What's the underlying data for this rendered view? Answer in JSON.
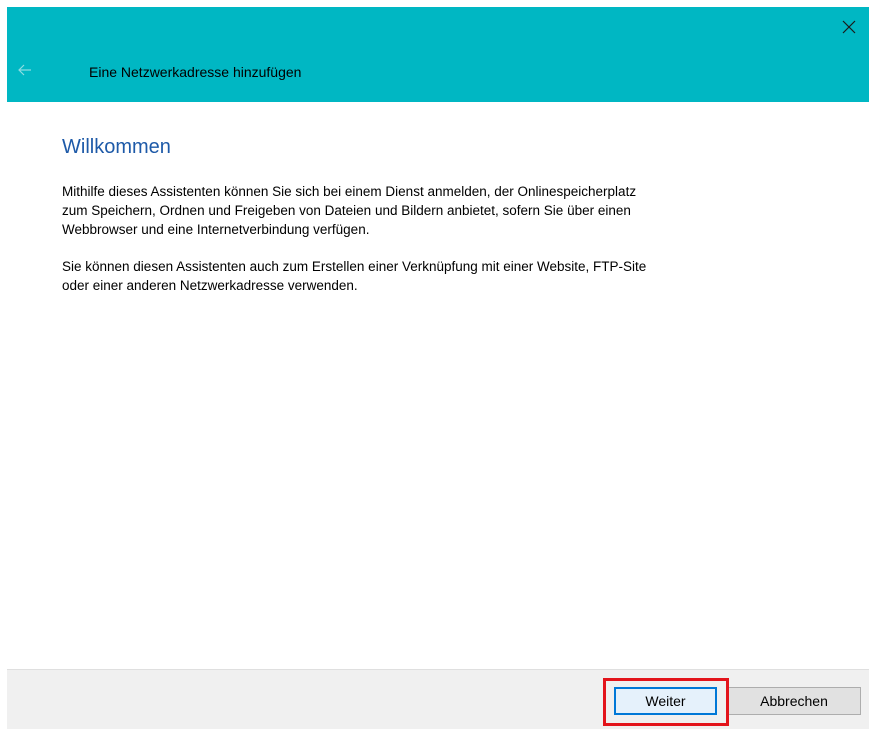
{
  "window": {
    "title": "Eine Netzwerkadresse hinzufügen",
    "accent_color": "#00b7c3",
    "close_icon": "close-icon",
    "back_icon": "back-arrow-icon"
  },
  "content": {
    "heading": "Willkommen",
    "paragraph1": "Mithilfe dieses Assistenten können Sie sich bei einem Dienst anmelden, der Onlinespeicherplatz\nzum Speichern, Ordnen und Freigeben von Dateien und Bildern anbietet, sofern Sie über einen\nWebbrowser und eine Internetverbindung verfügen.",
    "paragraph2": "Sie können diesen Assistenten auch zum Erstellen einer Verknüpfung mit einer Website, FTP-Site\noder einer anderen Netzwerkadresse verwenden."
  },
  "footer": {
    "next_label": "Weiter",
    "cancel_label": "Abbrechen",
    "highlight_color": "#e3141b"
  }
}
